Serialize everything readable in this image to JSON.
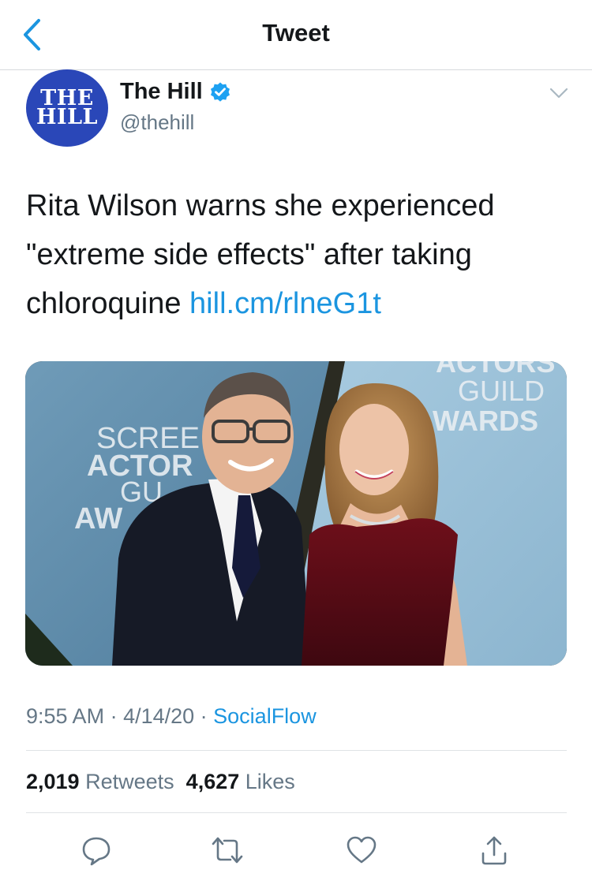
{
  "header": {
    "title": "Tweet"
  },
  "author": {
    "avatar_text_line1": "THE",
    "avatar_text_line2": "HILL",
    "name": "The Hill",
    "handle": "@thehill",
    "verified": true
  },
  "tweet": {
    "text": "Rita Wilson warns she experienced \"extreme side effects\" after taking chloroquine ",
    "link": "hill.cm/rlneG1t"
  },
  "media": {
    "backdrop_text_left": [
      "SCREE",
      "ACTOR",
      "GU",
      "AW"
    ],
    "backdrop_text_right": [
      "ACTORS",
      "GUILD",
      "AWARDS"
    ]
  },
  "meta": {
    "time": "9:55 AM",
    "separator": " · ",
    "date": "4/14/20",
    "source": "SocialFlow"
  },
  "stats": {
    "retweets_count": "2,019",
    "retweets_label": "Retweets",
    "likes_count": "4,627",
    "likes_label": "Likes"
  },
  "actions": [
    "reply-icon",
    "retweet-icon",
    "like-icon",
    "share-icon"
  ],
  "colors": {
    "link": "#1b95e0",
    "muted": "#657786",
    "text": "#14171a",
    "avatar_bg": "#2a47b8"
  }
}
